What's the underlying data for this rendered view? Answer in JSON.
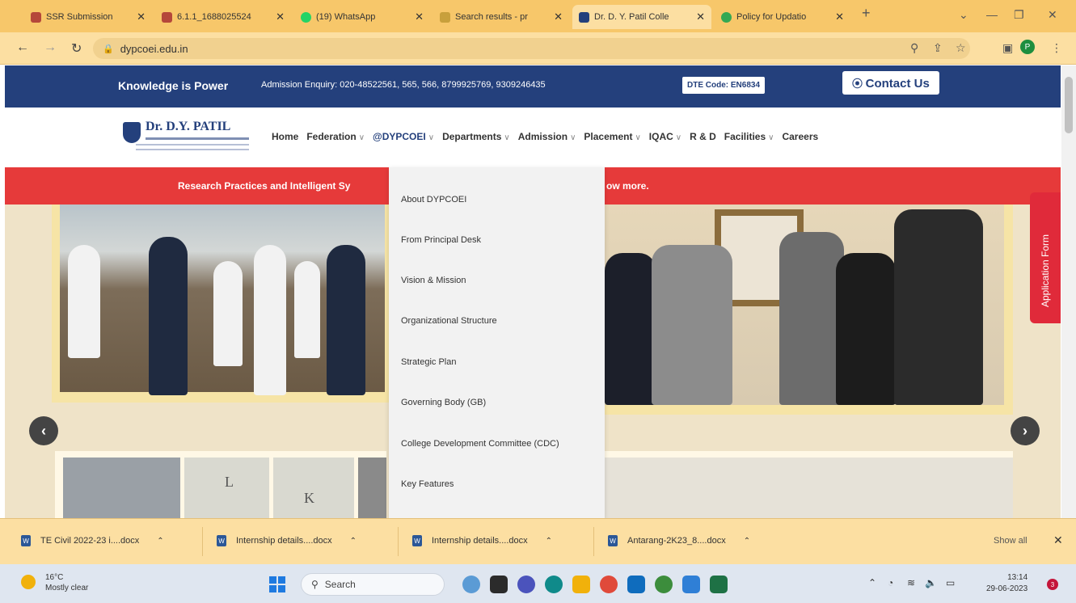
{
  "browser": {
    "tabs": [
      {
        "title": "SSR Submission",
        "color": "#b5473a"
      },
      {
        "title": "6.1.1_1688025524",
        "color": "#b5473a"
      },
      {
        "title": "(19) WhatsApp",
        "color": "#25d366"
      },
      {
        "title": "Search results - pr",
        "color": "#c8a03c"
      },
      {
        "title": "Dr. D. Y. Patil Colle",
        "color": "#24407c"
      },
      {
        "title": "Policy for Updatio",
        "color": "#34a853"
      }
    ],
    "new_tab": "+",
    "close": "✕",
    "url": "dypcoei.edu.in",
    "profile_initial": "P"
  },
  "site": {
    "tagline": "Knowledge is Power",
    "enquiry": "Admission Enquiry: 020-48522561, 565, 566, 8799925769, 9309246435",
    "dte_code": "DTE Code: EN6834",
    "contact": "Contact Us",
    "logo_name": "Dr. D.Y. PATIL",
    "nav": {
      "home": "Home",
      "federation": "Federation",
      "dypcoei": "@DYPCOEI",
      "departments": "Departments",
      "admission": "Admission",
      "placement": "Placement",
      "iqac": "IQAC",
      "rnd": "R & D",
      "facilities": "Facilities",
      "careers": "Careers"
    },
    "announcement_left": "Research Practices and Intelligent Sy",
    "announcement_right": "ow more.",
    "application_form": "Application Form",
    "prev": "‹",
    "next": "›",
    "sub_letters": [
      "L",
      "K"
    ]
  },
  "dropdown": [
    "About DYPCOEI",
    "From Principal Desk",
    "Vision & Mission",
    "Organizational Structure",
    "Strategic Plan",
    "Governing Body (GB)",
    "College Development Committee (CDC)",
    "Key Features"
  ],
  "downloads": {
    "items": [
      "TE Civil 2022-23 i....docx",
      "Internship details....docx",
      "Internship details....docx",
      "Antarang-2K23_8....docx"
    ],
    "show_all": "Show all"
  },
  "taskbar": {
    "temp": "16°C",
    "weather": "Mostly clear",
    "search": "Search",
    "time": "13:14",
    "date": "29-06-2023",
    "notif_count": "3"
  }
}
